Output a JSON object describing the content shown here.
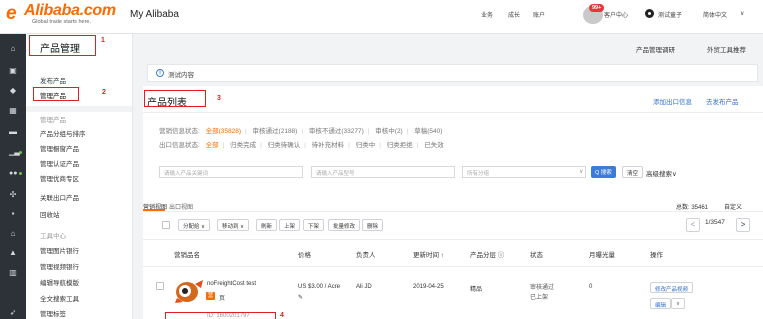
{
  "header": {
    "logo_text": "Alibaba.com",
    "logo_tagline": "Global trade starts here.",
    "app_title": "My Alibaba",
    "nav": [
      "业务",
      "成长",
      "账户"
    ],
    "message_badge": "99+",
    "message_label": "客户中心",
    "user_name": "测试童子",
    "language": "简体中文"
  },
  "sidebar_icons": [
    "home-icon",
    "product-icon",
    "shield-icon",
    "grid-icon",
    "chat-icon",
    "chart-icon",
    "people-icon",
    "settings-icon",
    "trophy-icon",
    "store-icon",
    "bag-icon",
    "send-icon"
  ],
  "menu": {
    "title": "产品管理",
    "items": [
      {
        "label": "发布产品",
        "muted": false
      },
      {
        "label": "管理产品",
        "muted": false
      },
      {
        "label": "管理产品",
        "muted": true
      },
      {
        "label": "产品分组与排序",
        "muted": false
      },
      {
        "label": "管理橱窗产品",
        "muted": false
      },
      {
        "label": "管理认证产品",
        "muted": false
      },
      {
        "label": "管理优商专区",
        "muted": false
      },
      {
        "label": "关联出口产品",
        "muted": false
      },
      {
        "label": "回收站",
        "muted": false
      },
      {
        "label": "工具中心",
        "muted": true
      },
      {
        "label": "管理图片银行",
        "muted": false
      },
      {
        "label": "管理视频银行",
        "muted": false
      },
      {
        "label": "编辑导航模版",
        "muted": false
      },
      {
        "label": "全文搜索工具",
        "muted": false
      },
      {
        "label": "管理标签",
        "muted": false
      }
    ]
  },
  "top_links": [
    "产品管理调研",
    "外贸工具推荐"
  ],
  "notice": {
    "icon": "i",
    "text": "测试内容"
  },
  "panel": {
    "title": "产品列表",
    "actions": [
      "添加出口信息",
      "去发布产品"
    ],
    "filter1": {
      "label": "营销信息状态:",
      "options": [
        "全部(35828)",
        "审核通过(2188)",
        "审核不通过(33277)",
        "审核中(2)",
        "草稿(540)"
      ]
    },
    "filter2": {
      "label": "出口信息状态:",
      "options": [
        "全部",
        "归类完成",
        "归类待确认",
        "待补充材料",
        "归类中",
        "归类拒绝",
        "已失效"
      ]
    },
    "inputs": {
      "keyword_placeholder": "请输入产品关键词",
      "model_placeholder": "请输入产品型号",
      "group_placeholder": "所有分组"
    },
    "search_button": "Q 搜索",
    "clear_button": "清空",
    "advanced_search": "高级搜索∨",
    "subtabs": {
      "active": "营销视图",
      "other": "出口视图"
    },
    "total": {
      "label": "总数: 35461",
      "custom": "自定义"
    },
    "toolbar": [
      "分配给 ∨",
      "移动到 ∨",
      "刷新",
      "上架",
      "下架",
      "批量修改",
      "删除"
    ],
    "pager": {
      "current": "1/3547",
      "prev": "<",
      "next": ">"
    },
    "columns": [
      "营销品名",
      "价格",
      "负责人",
      "更新时间 ↑",
      "产品分层 ⓘ",
      "状态",
      "月曝光量",
      "操作"
    ],
    "row": {
      "name": "noFreightCost test",
      "tag": "营",
      "tag_label": "页",
      "id_text": "ID: 1600201797",
      "price": "US $3.00 / Acre",
      "owner": "Ali JD",
      "updated": "2019-04-25",
      "tier": "精品",
      "status1": "审核通过",
      "status2": "已上架",
      "exposure": "0",
      "action1": "修改产品视频",
      "action2": "编辑",
      "action3": "∨"
    }
  },
  "annotations": [
    "1",
    "2",
    "3",
    "4"
  ],
  "colors": {
    "brand": "#ff6a00",
    "link": "#2f6ecf",
    "annotation": "#e02020",
    "sidebar": "#2d3138"
  }
}
